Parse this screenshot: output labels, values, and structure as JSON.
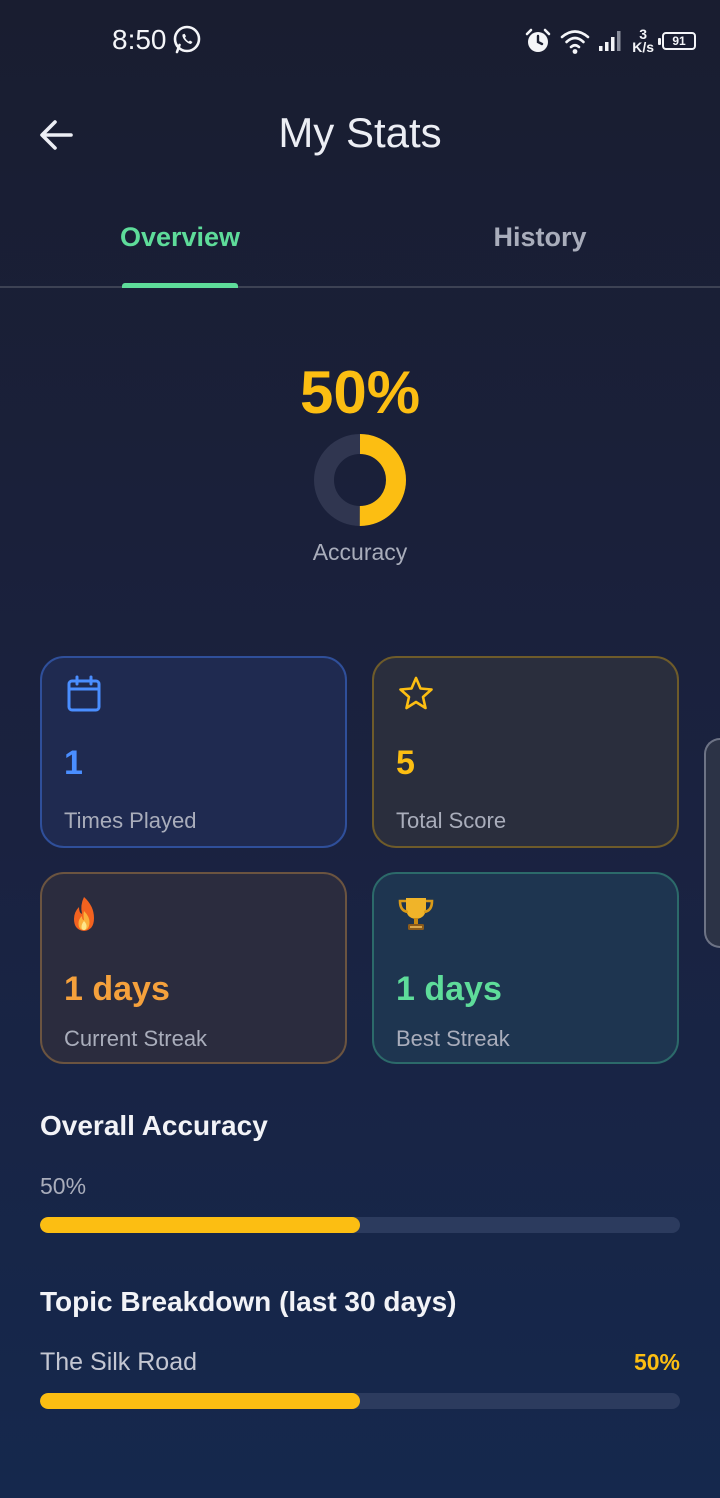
{
  "status_bar": {
    "time": "8:50",
    "net_speed_value": "3",
    "net_speed_unit": "K/s",
    "battery": "91"
  },
  "header": {
    "title": "My Stats"
  },
  "tabs": [
    {
      "label": "Overview",
      "active": true
    },
    {
      "label": "History",
      "active": false
    }
  ],
  "accuracy": {
    "value_text": "50%",
    "fraction": 0.5,
    "label": "Accuracy"
  },
  "cards": {
    "times_played": {
      "value": "1",
      "label": "Times Played",
      "icon": "calendar-icon"
    },
    "total_score": {
      "value": "5",
      "label": "Total Score",
      "icon": "star-icon"
    },
    "current_streak": {
      "value": "1 days",
      "label": "Current Streak",
      "icon": "fire-icon"
    },
    "best_streak": {
      "value": "1 days",
      "label": "Best Streak",
      "icon": "trophy-icon"
    }
  },
  "overall": {
    "title": "Overall Accuracy",
    "value_text": "50%",
    "fraction": 0.5
  },
  "topics": {
    "title": "Topic Breakdown (last 30 days)",
    "items": [
      {
        "name": "The Silk Road",
        "value_text": "50%",
        "fraction": 0.5
      }
    ]
  },
  "colors": {
    "accent_green": "#5edc9a",
    "accent_yellow": "#fcbe12",
    "accent_blue": "#4a8eff",
    "accent_orange": "#f5a13c"
  }
}
